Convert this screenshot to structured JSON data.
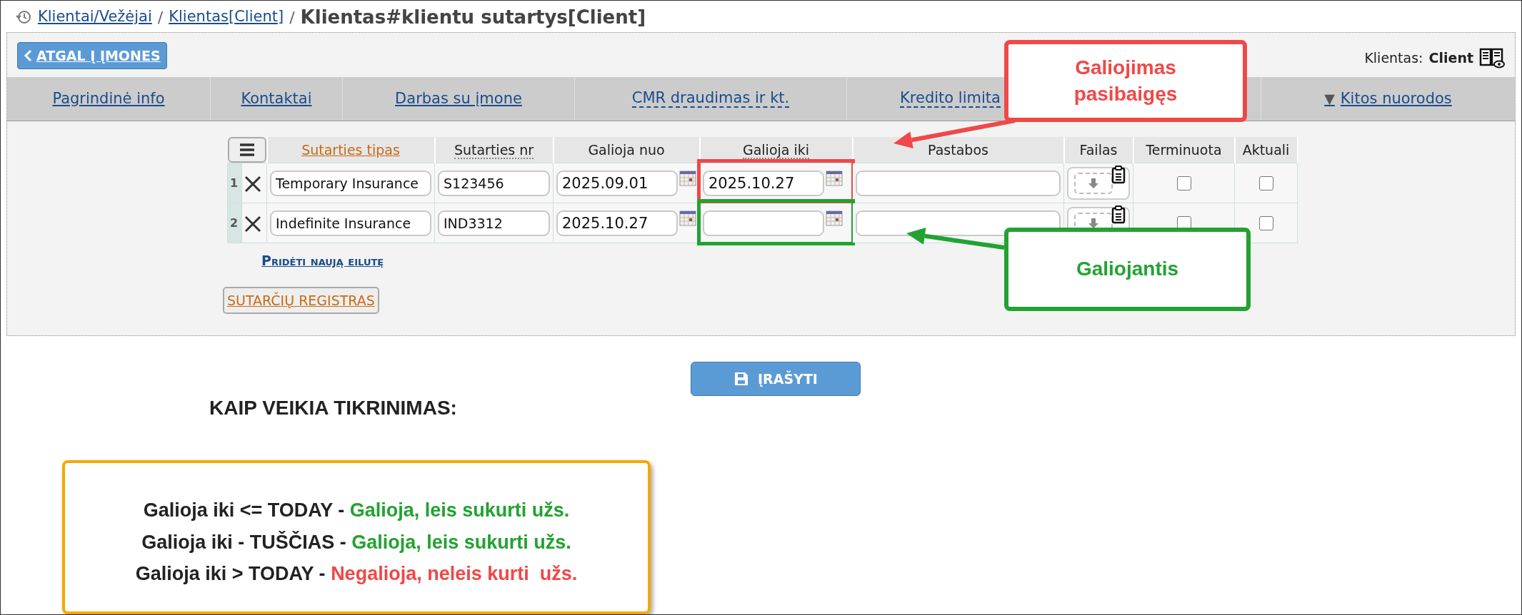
{
  "breadcrumb": [
    {
      "text": "Klientai/Vežėjai",
      "kind": "link"
    },
    {
      "text": "/",
      "kind": "separator"
    },
    {
      "text": "Klientas[Client]",
      "kind": "link"
    },
    {
      "text": "/",
      "kind": "separator"
    },
    {
      "text": "Klientas#klientu sutartys[Client]",
      "kind": "current"
    }
  ],
  "back_button": "ATGAL Į ĮMONES",
  "client": {
    "label": "Klientas:",
    "value": "Client"
  },
  "nav_tabs": [
    {
      "label": "Pagrindinė info",
      "dashed": false
    },
    {
      "label": "Kontaktai",
      "dashed": false
    },
    {
      "label": "Darbas su įmone",
      "dashed": false
    },
    {
      "label": "CMR draudimas ir kt.",
      "dashed": true
    },
    {
      "label": "Kredito limita",
      "dashed": true
    },
    {
      "label": "Kitos nuorodos",
      "dashed": false,
      "caret": "▼"
    }
  ],
  "table": {
    "columns": [
      {
        "label": "Sutarties tipas",
        "kind": "link"
      },
      {
        "label": "Sutarties nr",
        "kind": "tooltip"
      },
      {
        "label": "Galioja nuo",
        "kind": "plain"
      },
      {
        "label": "Galioja iki",
        "kind": "tooltip"
      },
      {
        "label": "Pastabos",
        "kind": "plain"
      },
      {
        "label": "Failas",
        "kind": "plain"
      },
      {
        "label": "Terminuota",
        "kind": "plain"
      },
      {
        "label": "Aktuali",
        "kind": "plain"
      }
    ],
    "rows": [
      {
        "number": "1",
        "type": "Temporary Insurance",
        "contract_nr": "S123456",
        "valid_from": "2025.09.01",
        "valid_until": "2025.10.27",
        "color": "#f04848",
        "fixed_term": false,
        "current": false
      },
      {
        "number": "2",
        "type": "Indefinite Insurance",
        "contract_nr": "IND3312",
        "valid_from": "2025.10.27",
        "color": "#22a232",
        "fixed_term": false,
        "current": false
      }
    ]
  },
  "add_row": "Pridėti naują eilutę",
  "registry_button": "SUTARČIŲ REGISTRAS",
  "save_button": "ĮRAŠYTI",
  "rules": {
    "title": "KAIP VEIKIA TIKRINIMAS:",
    "lines": [
      {
        "condition": "Galioja iki <= TODAY -",
        "result": "Galioja, leis sukurti užs.",
        "valid": true
      },
      {
        "condition": "Galioja iki - TUŠČIAS -",
        "result": "Galioja, leis sukurti užs.",
        "valid": true
      },
      {
        "condition": "Galioja iki > TODAY -",
        "result": "Negalioja, neleis kurti  užs.",
        "valid": false
      }
    ]
  },
  "annotations": [
    {
      "text": "Galiojimas pasibaigęs",
      "kind": "expired"
    },
    {
      "text": "Galiojantis",
      "kind": "valid"
    }
  ]
}
